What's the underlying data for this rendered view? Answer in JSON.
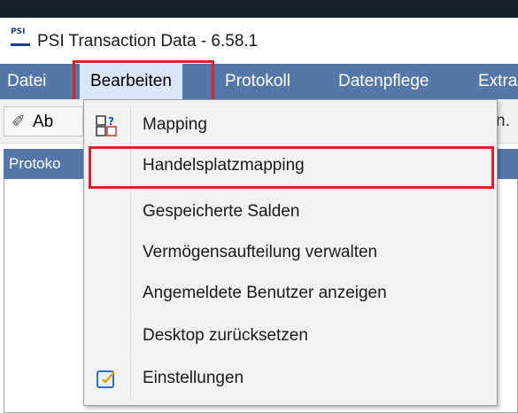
{
  "window": {
    "title": "PSI Transaction Data - 6.58.1",
    "logo_text": "PSI"
  },
  "menubar": {
    "items": [
      {
        "label": "Datei"
      },
      {
        "label": "Bearbeiten"
      },
      {
        "label": "Protokoll"
      },
      {
        "label": "Datenpflege"
      },
      {
        "label": "Extra"
      }
    ]
  },
  "toolbar": {
    "button_label": "Ab",
    "right_text": "n."
  },
  "panel": {
    "title": "Protoko"
  },
  "dropdown": {
    "items": [
      {
        "label": "Mapping",
        "icon": "mapping-icon"
      },
      {
        "label": "Handelsplatzmapping",
        "icon": ""
      },
      {
        "label": "Gespeicherte Salden",
        "icon": ""
      },
      {
        "label": "Vermögensaufteilung verwalten",
        "icon": ""
      },
      {
        "label": "Angemeldete Benutzer anzeigen",
        "icon": ""
      },
      {
        "label": "Desktop zurücksetzen",
        "icon": ""
      },
      {
        "label": "Einstellungen",
        "icon": "settings-icon"
      }
    ]
  },
  "colors": {
    "menubar": "#5577a8",
    "highlight": "#e01f26",
    "active_menu": "#d9e7fb"
  }
}
